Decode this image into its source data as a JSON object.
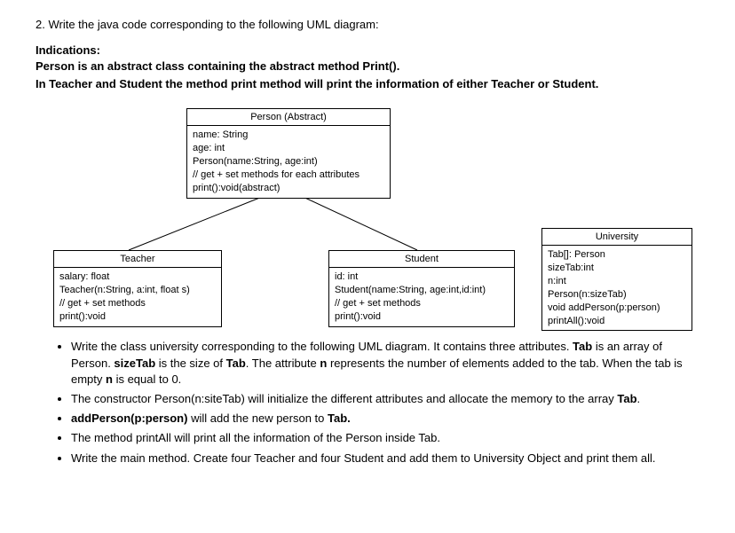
{
  "question_title": "2. Write the java code corresponding to the following UML diagram:",
  "indications_label": "Indications:",
  "indication1": "Person is an abstract class containing the abstract method Print().",
  "indication2": "In Teacher and Student the method print method will print the information of either Teacher or Student.",
  "uml": {
    "person": {
      "title": "Person (Abstract)",
      "l1": "name: String",
      "l2": "age: int",
      "l3": "Person(name:String, age:int)",
      "l4": "// get + set methods for each attributes",
      "l5": "print():void(abstract)"
    },
    "teacher": {
      "title": "Teacher",
      "l1": "salary: float",
      "l2": "Teacher(n:String, a:int, float s)",
      "l3": "// get + set methods",
      "l4": "print():void"
    },
    "student": {
      "title": "Student",
      "l1": "id: int",
      "l2": "Student(name:String, age:int,id:int)",
      "l3": "// get + set methods",
      "l4": "print():void"
    },
    "university": {
      "title": "University",
      "l1": "Tab[]: Person",
      "l2": "sizeTab:int",
      "l3": "n:int",
      "l4": "Person(n:sizeTab)",
      "l5": "void addPerson(p:person)",
      "l6": "printAll():void"
    }
  },
  "tasks": {
    "t1a": "Write the class university corresponding to the following UML diagram. It contains three attributes. ",
    "t1b": "Tab",
    "t1c": " is an array of Person. ",
    "t1d": "sizeTab",
    "t1e": " is the size of ",
    "t1f": "Tab",
    "t1g": ". The attribute ",
    "t1h": "n",
    "t1i": " represents the number of elements added to the tab. When the tab is empty ",
    "t1j": "n",
    "t1k": " is equal to 0.",
    "t2a": "The constructor Person(n:siteTab) will initialize the different attributes and allocate the memory to the array ",
    "t2b": "Tab",
    "t2c": ".",
    "t3a": "addPerson(p:person)",
    "t3b": " will add the new person to ",
    "t3c": "Tab.",
    "t4": "The method printAll will print all the information of the Person inside Tab.",
    "t5": "Write the main method. Create four Teacher and four Student and add them to University Object and print them all."
  }
}
